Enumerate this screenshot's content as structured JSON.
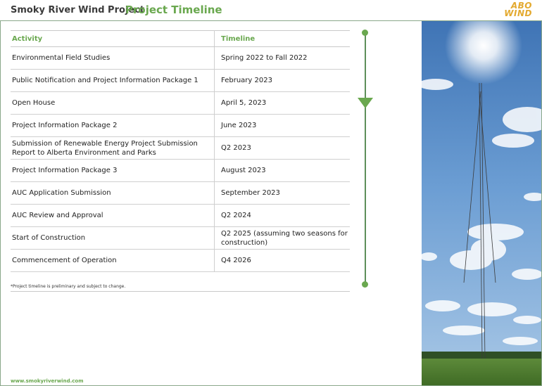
{
  "header": {
    "project_name": "Smoky River Wind Project",
    "title": "Project Timeline",
    "logo_line1": "ABO",
    "logo_line2": "WIND"
  },
  "table": {
    "columns": [
      "Activity",
      "Timeline"
    ],
    "rows": [
      {
        "activity": "Environmental Field Studies",
        "timeline": "Spring 2022 to Fall 2022"
      },
      {
        "activity": "Public Notification and Project Information Package 1",
        "timeline": "February 2023"
      },
      {
        "activity": "Open House",
        "timeline": "April 5, 2023"
      },
      {
        "activity": "Project Information Package 2",
        "timeline": "June 2023"
      },
      {
        "activity": "Submission of Renewable Energy Project Submission Report to Alberta Environment and Parks",
        "timeline": "Q2 2023"
      },
      {
        "activity": "Project Information Package 3",
        "timeline": "August  2023"
      },
      {
        "activity": "AUC Application Submission",
        "timeline": "September 2023"
      },
      {
        "activity": "AUC Review and Approval",
        "timeline": "Q2 2024"
      },
      {
        "activity": "Start of Construction",
        "timeline": "Q2 2025 (assuming two seasons for construction)"
      },
      {
        "activity": "Commencement of Operation",
        "timeline": "Q4 2026"
      }
    ]
  },
  "footnote": "*Project timeline is preliminary and subject to change.",
  "footer_url": "www.smokyriverwind.com",
  "colors": {
    "accent_green": "#6aa84f",
    "line_green": "#5e8f5a",
    "logo_orange": "#e3a92f"
  },
  "timeline_marker": {
    "current_row_index": 2
  }
}
